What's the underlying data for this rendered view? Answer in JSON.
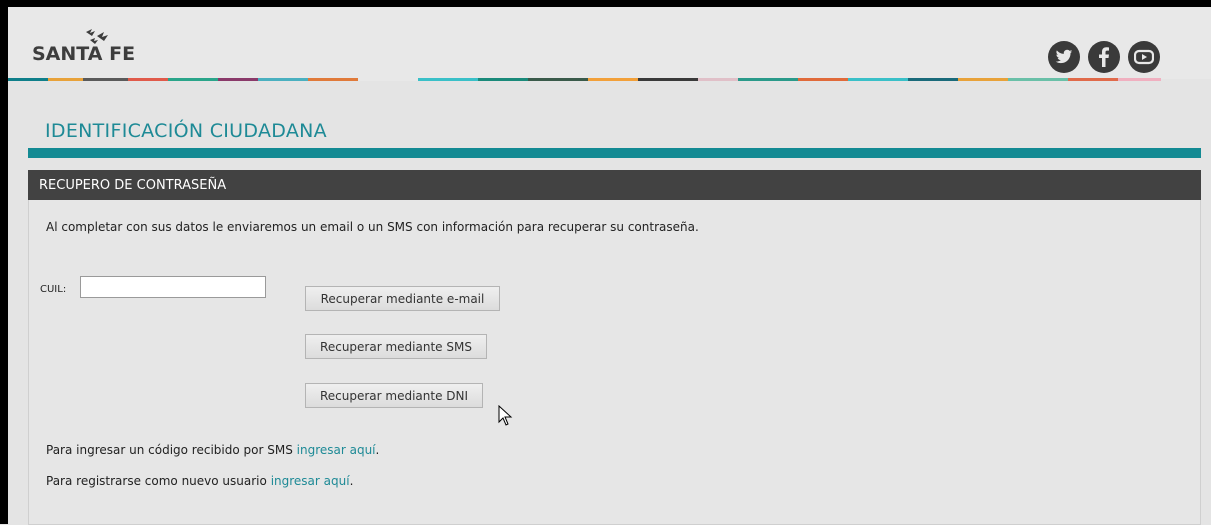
{
  "header": {
    "logo_text": "SANTA FE",
    "social": [
      {
        "icon": "twitter-icon",
        "glyph": "t"
      },
      {
        "icon": "facebook-icon",
        "glyph": "f"
      },
      {
        "icon": "youtube-icon",
        "glyph": "▶"
      }
    ]
  },
  "page": {
    "title": "IDENTIFICACIÓN CIUDADANA"
  },
  "panel": {
    "heading": "RECUPERO DE CONTRASEÑA",
    "intro": "Al completar con sus datos le enviaremos un email o un SMS con información para recuperar su contraseña.",
    "cuil_label": "CUIL:",
    "cuil_value": "",
    "buttons": {
      "email": "Recuperar mediante e-mail",
      "sms": "Recuperar mediante SMS",
      "dni": "Recuperar mediante DNI"
    },
    "sms_code_text": "Para ingresar un código recibido por SMS",
    "sms_code_link": "ingresar aquí",
    "register_text": "Para registrarse como nuevo usuario",
    "register_link": "ingresar aquí",
    "period": "."
  },
  "colors": {
    "accent": "#1e8a96",
    "title_bar": "#138a93",
    "panel_header": "#424242"
  }
}
